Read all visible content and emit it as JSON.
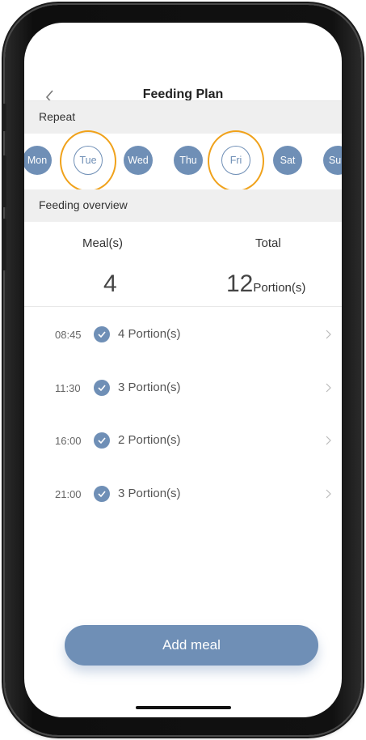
{
  "header": {
    "title": "Feeding Plan"
  },
  "repeat": {
    "label": "Repeat",
    "days": [
      {
        "label": "Mon",
        "selected": true
      },
      {
        "label": "Tue",
        "selected": false
      },
      {
        "label": "Wed",
        "selected": true
      },
      {
        "label": "Thu",
        "selected": true
      },
      {
        "label": "Fri",
        "selected": false
      },
      {
        "label": "Sat",
        "selected": true
      },
      {
        "label": "Sun",
        "selected": true
      }
    ]
  },
  "overview": {
    "label": "Feeding overview",
    "meals_label": "Meal(s)",
    "total_label": "Total",
    "meals_value": "4",
    "total_value": "12",
    "total_unit": "Portion(s)"
  },
  "meals": [
    {
      "time": "08:45",
      "portion": "4 Portion(s)"
    },
    {
      "time": "11:30",
      "portion": "3 Portion(s)"
    },
    {
      "time": "16:00",
      "portion": "2 Portion(s)"
    },
    {
      "time": "21:00",
      "portion": "3 Portion(s)"
    }
  ],
  "actions": {
    "add_meal": "Add meal"
  },
  "colors": {
    "accent": "#6f8fb6",
    "highlight_ring": "#f0a21b"
  }
}
